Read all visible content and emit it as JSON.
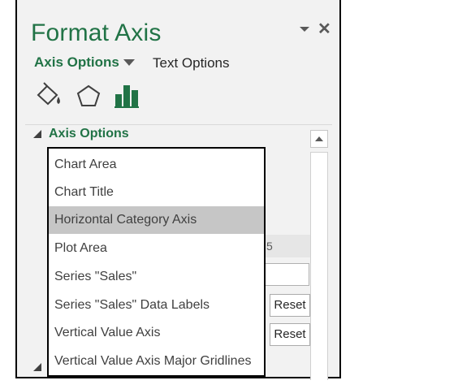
{
  "pane": {
    "title": "Format Axis",
    "dropdown_icon": "caret-down-icon",
    "close_glyph": "✕",
    "tabs": {
      "axis_options": "Axis Options",
      "text_options": "Text Options"
    },
    "icons": [
      "fill-line-icon",
      "effects-pentagon-icon",
      "bar-chart-icon"
    ],
    "section": {
      "title": "Axis Options"
    },
    "behind_value": "5",
    "reset_label_1": "Reset",
    "reset_label_2": "Reset",
    "accent_color": "#217346"
  },
  "dropdown": {
    "selected": "Horizontal Category Axis",
    "items": [
      "Chart Area",
      "Chart Title",
      "Horizontal Category Axis",
      "Plot Area",
      "Series \"Sales\"",
      "Series \"Sales\" Data Labels",
      "Vertical Value Axis",
      "Vertical Value Axis Major Gridlines"
    ]
  }
}
